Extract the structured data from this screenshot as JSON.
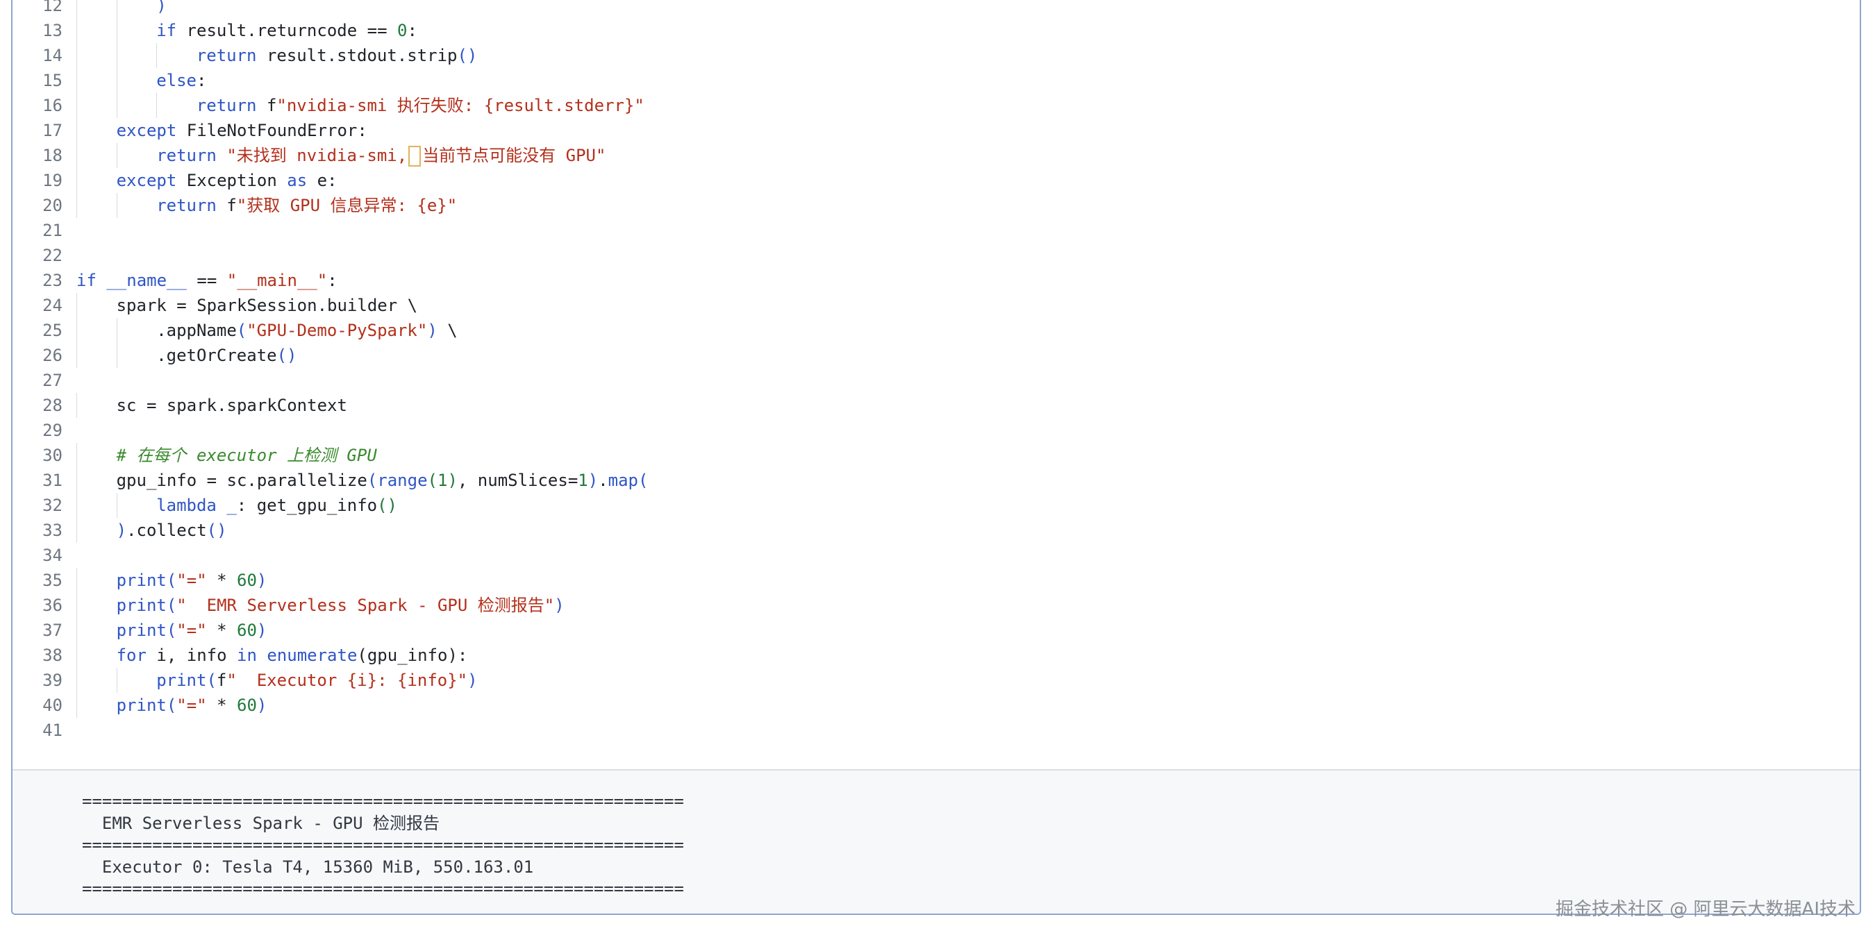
{
  "code_lines": [
    {
      "n": "12",
      "indent": 2,
      "tokens": [
        {
          "t": ")",
          "c": "br1"
        }
      ]
    },
    {
      "n": "13",
      "indent": 2,
      "tokens": [
        {
          "t": "if",
          "c": "kw"
        },
        {
          "t": " result.returncode == "
        },
        {
          "t": "0",
          "c": "nm"
        },
        {
          "t": ":"
        }
      ]
    },
    {
      "n": "14",
      "indent": 3,
      "tokens": [
        {
          "t": "return",
          "c": "kw"
        },
        {
          "t": " result.stdout.strip"
        },
        {
          "t": "()",
          "c": "br1"
        }
      ]
    },
    {
      "n": "15",
      "indent": 2,
      "tokens": [
        {
          "t": "else",
          "c": "kw"
        },
        {
          "t": ":"
        }
      ]
    },
    {
      "n": "16",
      "indent": 3,
      "tokens": [
        {
          "t": "return",
          "c": "kw"
        },
        {
          "t": " f"
        },
        {
          "t": "\"nvidia-smi 执行失败: {result.stderr}\"",
          "c": "st"
        }
      ]
    },
    {
      "n": "17",
      "indent": 1,
      "tokens": [
        {
          "t": "except",
          "c": "kw"
        },
        {
          "t": " FileNotFoundError:"
        }
      ]
    },
    {
      "n": "18",
      "indent": 2,
      "tokens": [
        {
          "t": "return",
          "c": "kw"
        },
        {
          "t": " "
        },
        {
          "t": "\"未找到 nvidia-smi,",
          "c": "st"
        },
        {
          "t": "",
          "c": "caret"
        },
        {
          "t": "当前节点可能没有 GPU\"",
          "c": "st"
        }
      ]
    },
    {
      "n": "19",
      "indent": 1,
      "tokens": [
        {
          "t": "except",
          "c": "kw"
        },
        {
          "t": " Exception "
        },
        {
          "t": "as",
          "c": "kw"
        },
        {
          "t": " e:"
        }
      ]
    },
    {
      "n": "20",
      "indent": 2,
      "tokens": [
        {
          "t": "return",
          "c": "kw"
        },
        {
          "t": " f"
        },
        {
          "t": "\"获取 GPU 信息异常: {e}\"",
          "c": "st"
        }
      ]
    },
    {
      "n": "21",
      "indent": 0,
      "tokens": []
    },
    {
      "n": "22",
      "indent": 0,
      "tokens": []
    },
    {
      "n": "23",
      "indent": 0,
      "tokens": [
        {
          "t": "if",
          "c": "kw"
        },
        {
          "t": " "
        },
        {
          "t": "__name__",
          "c": "kw"
        },
        {
          "t": " == "
        },
        {
          "t": "\"__main__\"",
          "c": "st"
        },
        {
          "t": ":"
        }
      ]
    },
    {
      "n": "24",
      "indent": 1,
      "tokens": [
        {
          "t": "spark = SparkSession.builder \\"
        }
      ]
    },
    {
      "n": "25",
      "indent": 2,
      "tokens": [
        {
          "t": ".appName"
        },
        {
          "t": "(",
          "c": "br1"
        },
        {
          "t": "\"GPU-Demo-PySpark\"",
          "c": "st"
        },
        {
          "t": ")",
          "c": "br1"
        },
        {
          "t": " \\"
        }
      ]
    },
    {
      "n": "26",
      "indent": 2,
      "tokens": [
        {
          "t": ".getOrCreate"
        },
        {
          "t": "()",
          "c": "br1"
        }
      ]
    },
    {
      "n": "27",
      "indent": 0,
      "tokens": []
    },
    {
      "n": "28",
      "indent": 1,
      "tokens": [
        {
          "t": "sc = spark.sparkContext"
        }
      ]
    },
    {
      "n": "29",
      "indent": 0,
      "tokens": []
    },
    {
      "n": "30",
      "indent": 1,
      "tokens": [
        {
          "t": "# 在每个 executor 上检测 GPU",
          "c": "cm"
        }
      ]
    },
    {
      "n": "31",
      "indent": 1,
      "tokens": [
        {
          "t": "gpu_info = sc.parallelize"
        },
        {
          "t": "(",
          "c": "br1"
        },
        {
          "t": "range",
          "c": "kw"
        },
        {
          "t": "(",
          "c": "br2"
        },
        {
          "t": "1",
          "c": "nm"
        },
        {
          "t": ")",
          "c": "br2"
        },
        {
          "t": ", numSlices="
        },
        {
          "t": "1",
          "c": "nm"
        },
        {
          "t": ")",
          "c": "br1"
        },
        {
          "t": "."
        },
        {
          "t": "map",
          "c": "kw"
        },
        {
          "t": "(",
          "c": "br1"
        }
      ]
    },
    {
      "n": "32",
      "indent": 2,
      "tokens": [
        {
          "t": "lambda",
          "c": "kw"
        },
        {
          "t": " "
        },
        {
          "t": "_",
          "c": "kw"
        },
        {
          "t": ": get_gpu_info"
        },
        {
          "t": "()",
          "c": "br2"
        }
      ]
    },
    {
      "n": "33",
      "indent": 1,
      "tokens": [
        {
          "t": ")",
          "c": "br1"
        },
        {
          "t": ".collect"
        },
        {
          "t": "()",
          "c": "br1"
        }
      ]
    },
    {
      "n": "34",
      "indent": 0,
      "tokens": []
    },
    {
      "n": "35",
      "indent": 1,
      "tokens": [
        {
          "t": "print",
          "c": "kw"
        },
        {
          "t": "(",
          "c": "br1"
        },
        {
          "t": "\"=\"",
          "c": "st"
        },
        {
          "t": " * "
        },
        {
          "t": "60",
          "c": "nm"
        },
        {
          "t": ")",
          "c": "br1"
        }
      ]
    },
    {
      "n": "36",
      "indent": 1,
      "tokens": [
        {
          "t": "print",
          "c": "kw"
        },
        {
          "t": "(",
          "c": "br1"
        },
        {
          "t": "\"  EMR Serverless Spark - GPU 检测报告\"",
          "c": "st"
        },
        {
          "t": ")",
          "c": "br1"
        }
      ]
    },
    {
      "n": "37",
      "indent": 1,
      "tokens": [
        {
          "t": "print",
          "c": "kw"
        },
        {
          "t": "(",
          "c": "br1"
        },
        {
          "t": "\"=\"",
          "c": "st"
        },
        {
          "t": " * "
        },
        {
          "t": "60",
          "c": "nm"
        },
        {
          "t": ")",
          "c": "br1"
        }
      ]
    },
    {
      "n": "38",
      "indent": 1,
      "tokens": [
        {
          "t": "for",
          "c": "kw"
        },
        {
          "t": " i, info "
        },
        {
          "t": "in",
          "c": "kw"
        },
        {
          "t": " "
        },
        {
          "t": "enumerate",
          "c": "kw"
        },
        {
          "t": "(gpu_info):"
        }
      ]
    },
    {
      "n": "39",
      "indent": 2,
      "tokens": [
        {
          "t": "print",
          "c": "kw"
        },
        {
          "t": "(",
          "c": "br1"
        },
        {
          "t": "f"
        },
        {
          "t": "\"  Executor {i}: {info}\"",
          "c": "st"
        },
        {
          "t": ")",
          "c": "br1"
        }
      ]
    },
    {
      "n": "40",
      "indent": 1,
      "tokens": [
        {
          "t": "print",
          "c": "kw"
        },
        {
          "t": "(",
          "c": "br1"
        },
        {
          "t": "\"=\"",
          "c": "st"
        },
        {
          "t": " * "
        },
        {
          "t": "60",
          "c": "nm"
        },
        {
          "t": ")",
          "c": "br1"
        }
      ]
    },
    {
      "n": "41",
      "indent": 0,
      "tokens": []
    }
  ],
  "output_lines": [
    "============================================================",
    "  EMR Serverless Spark - GPU 检测报告",
    "============================================================",
    "  Executor 0: Tesla T4, 15360 MiB, 550.163.01",
    "============================================================"
  ],
  "watermark": "掘金技术社区 @ 阿里云大数据AI技术",
  "colors": {
    "keyword": "#2f55c6",
    "string": "#b3301c",
    "number": "#1f7a3a",
    "comment": "#3a8a2e",
    "output_bg": "#f6f8fa",
    "frame_border": "#8fa6cd"
  }
}
